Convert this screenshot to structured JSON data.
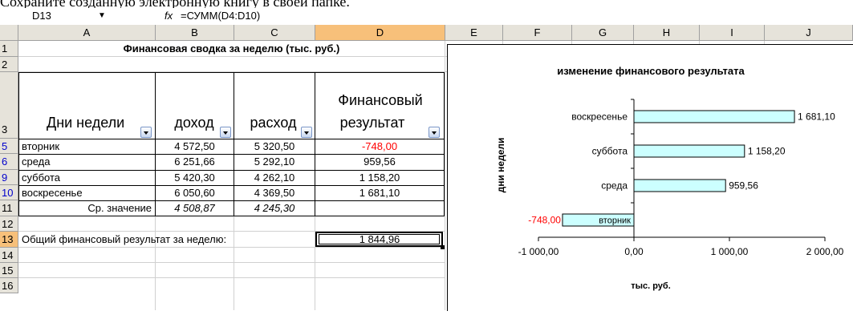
{
  "caption": "Сохраните созданную электронную книгу в своей папке.",
  "formula_bar": {
    "name_box": "D13",
    "fx": "fx",
    "formula": "=СУММ(D4:D10)"
  },
  "columns": [
    "A",
    "B",
    "C",
    "D",
    "E",
    "F",
    "G",
    "H",
    "I",
    "J"
  ],
  "rows": [
    "1",
    "2",
    "3",
    "5",
    "6",
    "9",
    "10",
    "11",
    "12",
    "13",
    "14",
    "15",
    "16"
  ],
  "sheet": {
    "title": "Финансовая сводка за неделю (тыс. руб.)",
    "headers": {
      "days": "Дни недели",
      "income": "доход",
      "expense": "расход",
      "result1": "Финансовый",
      "result2": "результат"
    },
    "table": [
      {
        "day": "вторник",
        "income": "4 572,50",
        "expense": "5 320,50",
        "result": "-748,00"
      },
      {
        "day": "среда",
        "income": "6 251,66",
        "expense": "5 292,10",
        "result": "959,56"
      },
      {
        "day": "суббота",
        "income": "5 420,30",
        "expense": "4 262,10",
        "result": "1 158,20"
      },
      {
        "day": "воскресенье",
        "income": "6 050,60",
        "expense": "4 369,50",
        "result": "1 681,10"
      }
    ],
    "avg_label": "Ср. значение",
    "avg_income": "4 508,87",
    "avg_expense": "4 245,30",
    "total_label": "Общий финансовый результат за неделю:",
    "total_value": "1 844,96"
  },
  "chart_data": {
    "type": "bar",
    "orientation": "horizontal",
    "title": "изменение финансового результата",
    "xlabel": "тыс. руб.",
    "ylabel": "дни недели",
    "categories": [
      "вторник",
      "среда",
      "суббота",
      "воскресенье"
    ],
    "values": [
      -748.0,
      959.56,
      1158.2,
      1681.1
    ],
    "data_labels": [
      "-748,00",
      "959,56",
      "1 158,20",
      "1 681,10"
    ],
    "xlim": [
      -1000,
      2000
    ],
    "x_ticks": [
      "-1 000,00",
      "0,00",
      "1 000,00",
      "2 000,00"
    ],
    "bar_color": "#ccffff",
    "negative_label_color": "#ff0000"
  }
}
